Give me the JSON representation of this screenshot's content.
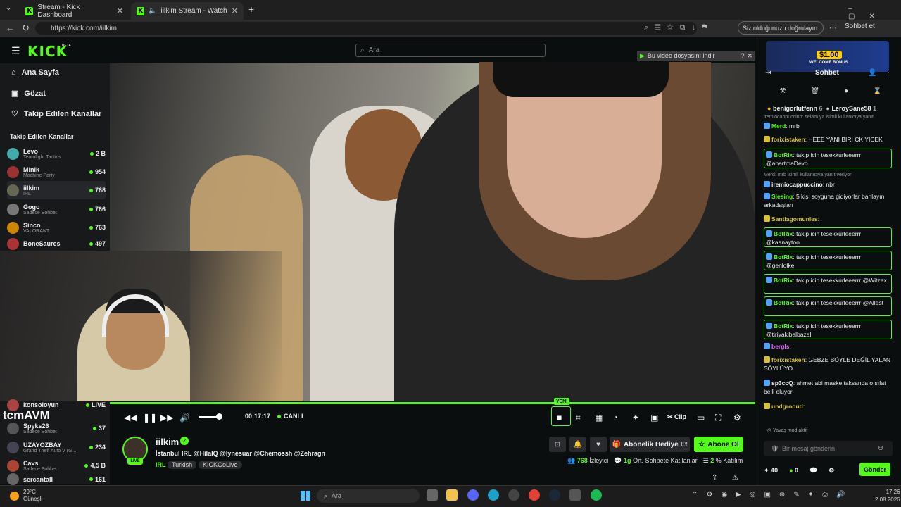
{
  "browser": {
    "tabs": [
      {
        "label": "Stream - Kick Dashboard"
      },
      {
        "label": "iilkim Stream - Watch Live on"
      }
    ],
    "url": "https://kick.com/iilkim",
    "verify_label": "Siz olduğunuzu doğrulayın",
    "copilot_label": "Sohbet et"
  },
  "kick": {
    "logo": "KICK",
    "beta": "BETA",
    "search_placeholder": "Ara",
    "download_banner": "Bu video dosyasını indir",
    "nav": [
      {
        "label": "Ana Sayfa",
        "icon": "home-icon"
      },
      {
        "label": "Gözat",
        "icon": "browse-icon"
      },
      {
        "label": "Takip Edilen Kanallar",
        "icon": "heart-icon"
      }
    ],
    "followed_title": "Takip Edilen Kanallar",
    "channels": [
      {
        "name": "Levo",
        "category": "Teamfight Tactics",
        "viewers": "2 B"
      },
      {
        "name": "Minik",
        "category": "Machine Party",
        "viewers": "954"
      },
      {
        "name": "iilkim",
        "category": "IRL",
        "viewers": "768"
      },
      {
        "name": "Gogo",
        "category": "Sadece Sohbet",
        "viewers": "766"
      },
      {
        "name": "Sinco",
        "category": "VALORANT",
        "viewers": "763"
      },
      {
        "name": "BoneSaures",
        "category": "",
        "viewers": "497"
      }
    ],
    "channels_lower": [
      {
        "name": "konsoloyun",
        "category": "",
        "viewers": "LIVE"
      },
      {
        "name": "Spyks26",
        "category": "Sadece Sohbet",
        "viewers": "37"
      },
      {
        "name": "UZAYOZBAY",
        "category": "Grand Theft Auto V (G...",
        "viewers": "234"
      },
      {
        "name": "Cavs",
        "category": "Sadece Sohbet",
        "viewers": "4,5 B"
      },
      {
        "name": "sercantall",
        "category": "",
        "viewers": "161"
      }
    ],
    "overlay_text": "tcmAVM"
  },
  "player": {
    "time": "00:17:17",
    "live_label": "CANLI",
    "new_badge": "YENİ",
    "clip_label": "Clip",
    "volume_level": 0.8
  },
  "stream": {
    "name": "iilkim",
    "live_badge": "LIVE",
    "title": "İstanbul IRL @HilalQ @lynesuar @Chemossh @Zehragn",
    "category": "IRL",
    "tags": [
      "Turkish",
      "KICKGoLive"
    ],
    "gift_label": "Abonelik Hediye Et",
    "subscribe_label": "Abone Ol",
    "viewers": "768",
    "viewers_label": "İzleyici",
    "avg_time": "1g",
    "avg_label": "Ort. Sohbete Katılanlar",
    "percent": "2",
    "percent_label": "% Katılım"
  },
  "chat": {
    "promo_amount": "$1.00",
    "promo_text": "WELCOME BONUS",
    "title": "Sohbet",
    "pinned": [
      {
        "name": "benigorlutfenn",
        "count": "6"
      },
      {
        "name": "LeroySane58",
        "count": "1"
      }
    ],
    "messages": [
      {
        "type": "reply",
        "text": "iremiocappuccino: selam ya isimli kullanıcıya yanıt..."
      },
      {
        "type": "msg",
        "user": "Merd",
        "text": "mrb",
        "color": "#53fc18"
      },
      {
        "type": "msg",
        "user": "forixistaken",
        "text": "HEEE YANİ BİRİ CK YİCEK",
        "color": "#d4c232"
      },
      {
        "type": "bot",
        "user": "BotRix",
        "text": "takip icin tesekkurleeerrr @abartmaDevo"
      },
      {
        "type": "reply",
        "text": "Merd: mrb isimli kullanıcıya yanıt veriyor"
      },
      {
        "type": "msg",
        "user": "iremiocappuccino",
        "text": "nbr",
        "color": "#eee"
      },
      {
        "type": "msg",
        "user": "Siesing",
        "text": "5 kişi soyguna gidiyorlar banlayın arkadaşları",
        "color": "#53fc18"
      },
      {
        "type": "msg",
        "user": "Santiagomunies",
        "text": "",
        "color": "#d4c232"
      },
      {
        "type": "bot",
        "user": "BotRix",
        "text": "takip icin tesekkurleeerrr @kaanaytoo"
      },
      {
        "type": "bot",
        "user": "BotRix",
        "text": "takip icin tesekkurleeerrr @genlolke"
      },
      {
        "type": "bot",
        "user": "BotRix",
        "text": "takip icin tesekkurleeerrr @Witzex"
      },
      {
        "type": "bot",
        "user": "BotRix",
        "text": "takip icin tesekkurleeerrr @Allest"
      },
      {
        "type": "bot",
        "user": "BotRix",
        "text": "takip icin tesekkurleeerrr @tiriyakibalbazal"
      },
      {
        "type": "msg",
        "user": "bergls",
        "text": "",
        "color": "#e36bff"
      },
      {
        "type": "msg",
        "user": "forixistaken",
        "text": "GEBZE BÖYLE DEĞİL YALAN SÖYLÜYO",
        "color": "#d4c232"
      },
      {
        "type": "msg",
        "user": "sp3ccQ",
        "text": "ahmet abi maske taksanda o sıfat belli oluyor",
        "color": "#eee"
      },
      {
        "type": "msg",
        "user": "undgrooud",
        "text": "",
        "color": "#d4c232"
      }
    ],
    "slow_mode": "Yavaş mod aktif",
    "input_placeholder": "Bir mesaj gönderin",
    "points": "40",
    "zero": "0",
    "send_label": "Gönder"
  },
  "taskbar": {
    "temp": "29°C",
    "weather": "Güneşli",
    "search": "Ara",
    "time": "17:26",
    "date": "2.08.2026"
  }
}
